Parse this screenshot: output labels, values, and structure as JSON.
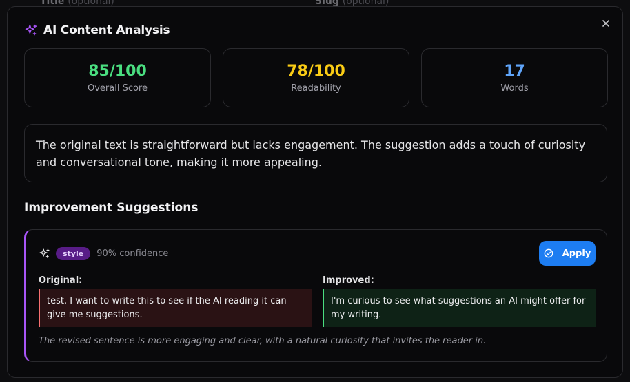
{
  "background_form": {
    "title_label": "Title",
    "title_optional": "(optional)",
    "slug_label": "Slug",
    "slug_optional": "(optional)"
  },
  "modal": {
    "title": "AI Content Analysis",
    "close_icon": "close-icon",
    "accent_color": "#a855f7"
  },
  "stats": [
    {
      "value": "85/100",
      "label": "Overall Score",
      "color": "#4ade80"
    },
    {
      "value": "78/100",
      "label": "Readability",
      "color": "#facc15"
    },
    {
      "value": "17",
      "label": "Words",
      "color": "#60a5fa"
    }
  ],
  "summary": "The original text is straightforward but lacks engagement. The suggestion adds a touch of curiosity and conversational tone, making it more appealing.",
  "suggestions_section": {
    "title": "Improvement Suggestions",
    "items": [
      {
        "type": "style",
        "confidence": "90% confidence",
        "apply_label": "Apply",
        "original_label": "Original:",
        "original_text": "test. I want to write this to see if the AI reading it can give me suggestions.",
        "improved_label": "Improved:",
        "improved_text": "I'm curious to see what suggestions an AI might offer for my writing.",
        "reason": "The revised sentence is more engaging and clear, with a natural curiosity that invites the reader in."
      }
    ]
  }
}
